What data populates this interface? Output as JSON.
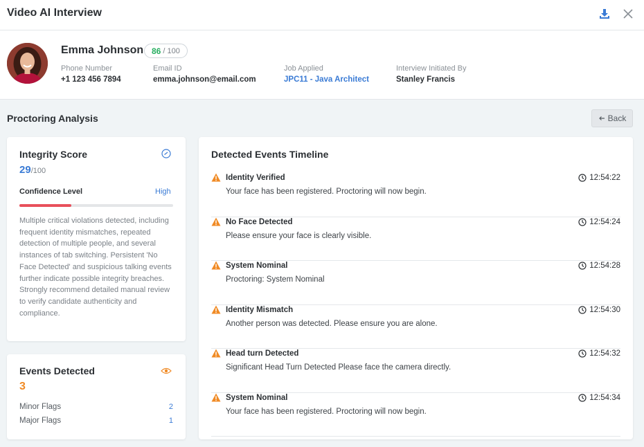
{
  "window": {
    "title": "Video AI Interview"
  },
  "candidate": {
    "name": "Emma Johnson",
    "score": "86",
    "score_max": "/ 100",
    "fields": [
      {
        "label": "Phone Number",
        "value": "+1 123 456 7894"
      },
      {
        "label": "Email ID",
        "value": "emma.johnson@email.com"
      },
      {
        "label": "Job Applied",
        "value": "JPC11 - Java Architect"
      },
      {
        "label": "Interview Initiated By",
        "value": "Stanley Francis"
      }
    ]
  },
  "proctoring": {
    "title": "Proctoring Analysis",
    "back_label": "Back"
  },
  "integrity": {
    "title": "Integrity Score",
    "score": "29",
    "max": "/100",
    "confidence_label": "Confidence Level",
    "confidence_value": "High",
    "confidence_fraction": 0.34,
    "description": "Multiple critical violations detected, including frequent identity mismatches, repeated detection of multiple people, and several instances of tab switching. Persistent 'No Face Detected' and suspicious talking events further indicate possible integrity breaches. Strongly recommend detailed manual review to verify candidate authenticity and compliance."
  },
  "events_detected": {
    "title": "Events Detected",
    "count": "3",
    "minor_label": "Minor Flags",
    "minor_count": "2",
    "major_label": "Major Flags",
    "major_count": "1"
  },
  "timeline": {
    "title": "Detected Events Timeline",
    "events": [
      {
        "title": "Identity Verified",
        "message": "Your face has been registered. Proctoring will now begin.",
        "time": "12:54:22"
      },
      {
        "title": "No Face Detected",
        "message": "Please ensure your face is clearly visible.",
        "time": "12:54:24"
      },
      {
        "title": "System Nominal",
        "message": "Proctoring: System Nominal",
        "time": "12:54:28"
      },
      {
        "title": "Identity Mismatch",
        "message": "Another person was detected. Please ensure you are alone.",
        "time": "12:54:30"
      },
      {
        "title": "Head turn Detected",
        "message": "Significant Head Turn Detected Please face the camera directly.",
        "time": "12:54:32"
      },
      {
        "title": "System Nominal",
        "message": "Your face has been registered. Proctoring will now begin.",
        "time": "12:54:34"
      }
    ]
  },
  "colors": {
    "accent": "#3a7bd5",
    "score_green": "#27ae60",
    "warning": "#f08a24",
    "confidence_bar": "#e8505b"
  }
}
